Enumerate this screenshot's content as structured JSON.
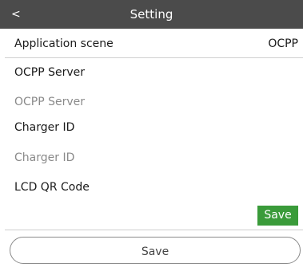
{
  "header": {
    "back_label": "<",
    "title": "Setting"
  },
  "application_scene": {
    "label": "Application scene",
    "value": "OCPP"
  },
  "ocpp_server": {
    "label": "OCPP Server",
    "placeholder": "OCPP Server",
    "value": ""
  },
  "charger_id": {
    "label": "Charger ID",
    "placeholder": "Charger ID",
    "value": ""
  },
  "lcd_qr_code": {
    "label": "LCD QR Code"
  },
  "actions": {
    "save_small_label": "Save",
    "save_big_label": "Save"
  }
}
